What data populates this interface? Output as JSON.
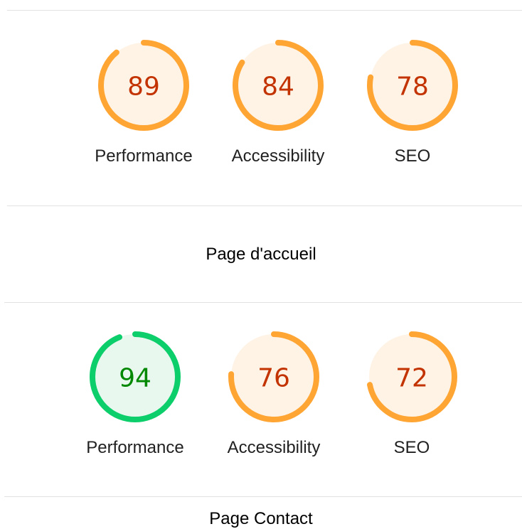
{
  "colors": {
    "average": {
      "arc": "#ffa534",
      "fill": "#fff3e6",
      "text": "#c33300"
    },
    "pass": {
      "arc": "#0cce6b",
      "fill": "#e9f8ef",
      "text": "#008800"
    }
  },
  "sections": [
    {
      "gauges": [
        {
          "label": "Performance",
          "score": 89,
          "rating": "average"
        },
        {
          "label": "Accessibility",
          "score": 84,
          "rating": "average"
        },
        {
          "label": "SEO",
          "score": 78,
          "rating": "average"
        }
      ],
      "title": "Page d'accueil"
    },
    {
      "gauges": [
        {
          "label": "Performance",
          "score": 94,
          "rating": "pass"
        },
        {
          "label": "Accessibility",
          "score": 76,
          "rating": "average"
        },
        {
          "label": "SEO",
          "score": 72,
          "rating": "average"
        }
      ],
      "title": "Page Contact"
    }
  ]
}
